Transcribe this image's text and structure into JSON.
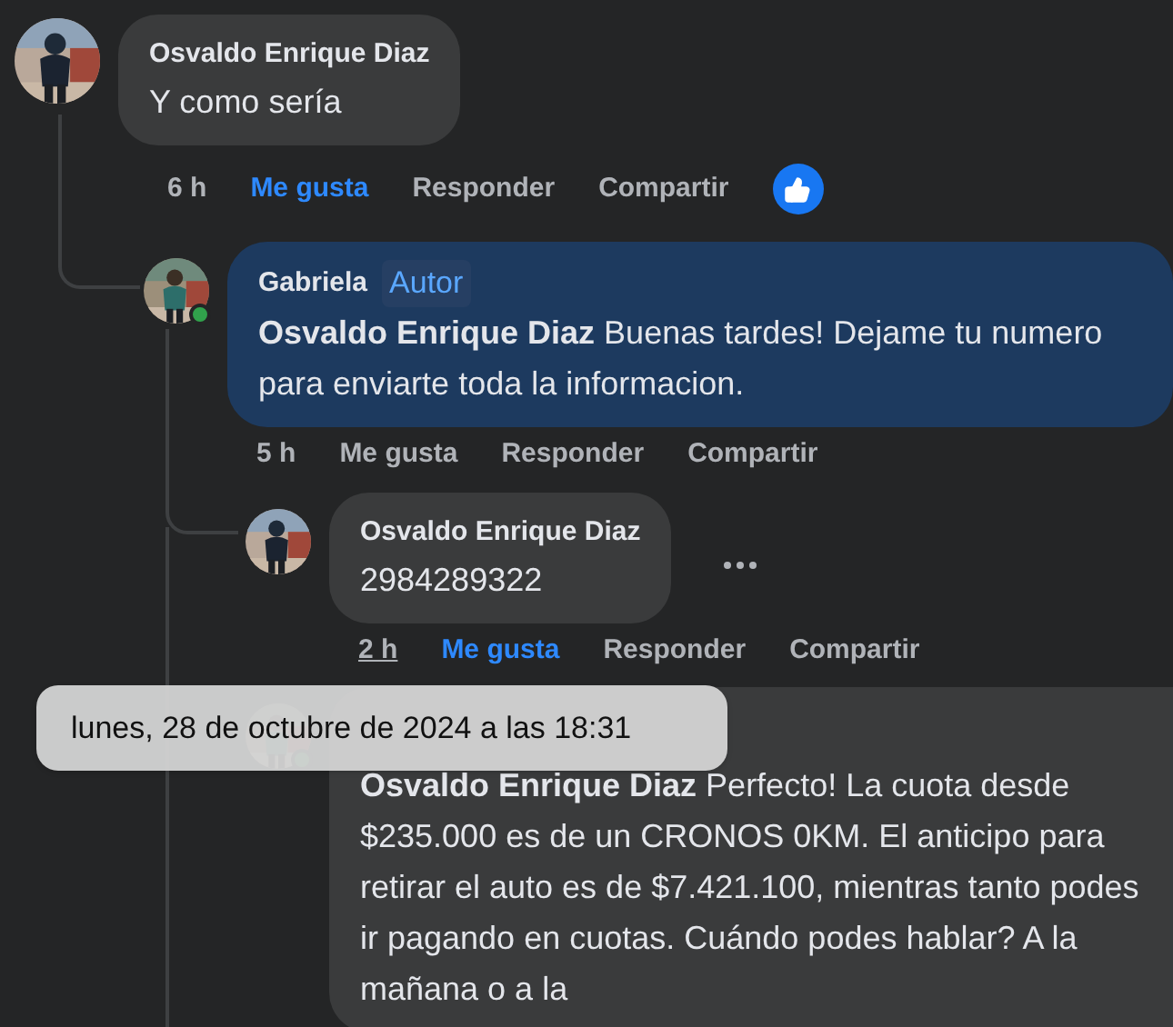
{
  "comments": [
    {
      "author": "Osvaldo Enrique Diaz",
      "text": "Y como sería",
      "time": "6 h",
      "time_hovered": false,
      "like": "Me gusta",
      "liked": true,
      "reply": "Responder",
      "share": "Compartir",
      "reaction": true,
      "highlight": false,
      "children": [
        {
          "author": "Gabriela",
          "badge": "Autor",
          "text": "**Osvaldo Enrique Diaz** Buenas tardes! Dejame tu numero para enviarte toda la informacion.",
          "time": "5 h",
          "time_hovered": false,
          "like": "Me gusta",
          "liked": false,
          "reply": "Responder",
          "share": "Compartir",
          "highlight": true,
          "online": true,
          "children": [
            {
              "author": "Osvaldo Enrique Diaz",
              "text": "2984289322",
              "time": "2 h",
              "time_hovered": true,
              "like": "Me gusta",
              "liked": true,
              "reply": "Responder",
              "share": "Compartir",
              "highlight": false,
              "more": true
            },
            {
              "text": "**Osvaldo Enrique Diaz** Perfecto! La cuota desde $235.000 es de un CRONOS 0KM. El anticipo para retirar el auto es de $7.421.100, mientras tanto podes ir pagando en cuotas. Cuándo podes hablar? A la mañana o a la",
              "highlight": false,
              "online": true
            }
          ]
        }
      ]
    }
  ],
  "tooltip": "lunes, 28 de octubre de 2024 a las 18:31"
}
